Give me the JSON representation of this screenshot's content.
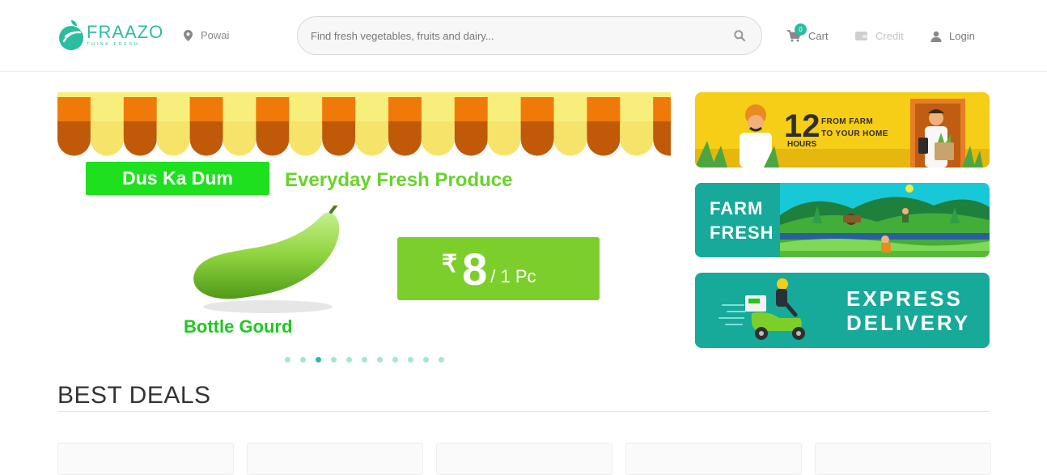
{
  "header": {
    "logo_word": "FRAAZO",
    "logo_tagline": "THINK FRESH",
    "location": "Powai",
    "search_placeholder": "Find fresh vegetables, fruits and dairy...",
    "cart_label": "Cart",
    "cart_count": "0",
    "credit_label": "Credit",
    "login_label": "Login"
  },
  "hero": {
    "badge": "Dus Ka Dum",
    "tagline": "Everyday Fresh Produce",
    "product": "Bottle Gourd",
    "price_symbol": "₹",
    "price": "8",
    "unit": "/ 1 Pc",
    "slides": 11,
    "active_slide": 3
  },
  "side_banners": [
    {
      "big": "12",
      "small": "HOURS",
      "line1": "FROM FARM",
      "line2": "TO YOUR HOME"
    },
    {
      "line1": "FARM",
      "line2": "FRESH"
    },
    {
      "line1": "EXPRESS",
      "line2": "DELIVERY"
    }
  ],
  "deals": {
    "title": "BEST DEALS",
    "card_count": 5
  },
  "colors": {
    "brand": "#2bbd9f",
    "awning_orange": "#ef7a0a",
    "awning_yellow": "#f8ee7c",
    "banner_yellow": "#f6cd17",
    "banner_teal": "#17a99a",
    "price_green": "#7ccf2a"
  }
}
